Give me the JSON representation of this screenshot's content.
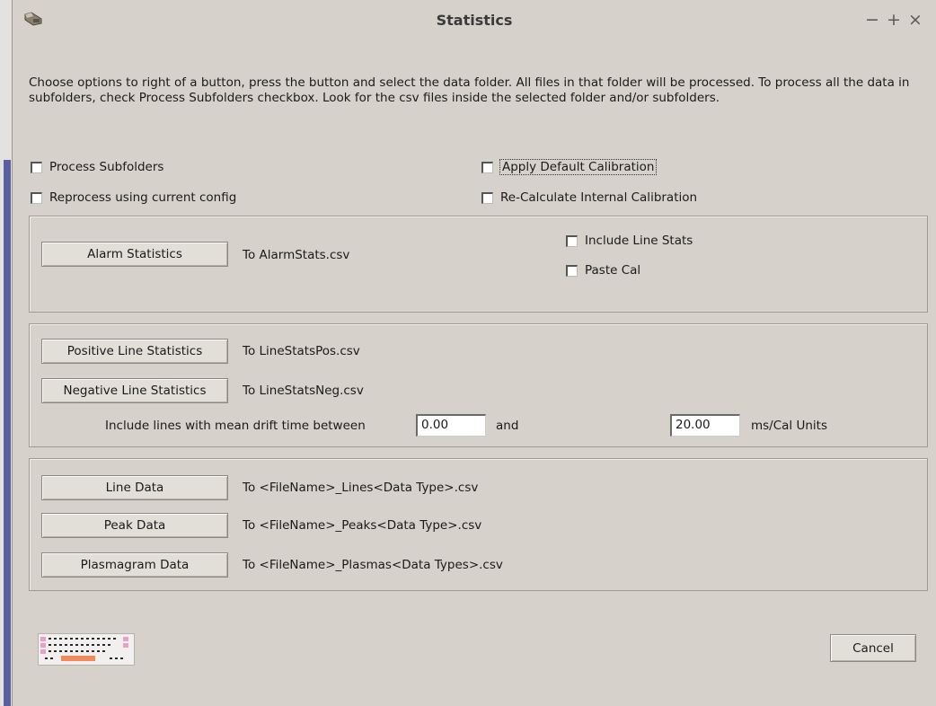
{
  "window": {
    "title": "Statistics",
    "controls": {
      "minimize": "−",
      "maximize": "+",
      "close": "×"
    }
  },
  "intro_text": "Choose options to right of a button, press the button and select the data folder. All files in that folder will be processed. To process all the data in subfolders, check Process Subfolders checkbox. Look for the csv files inside the selected folder and/or subfolders.",
  "options": {
    "process_subfolders": {
      "label": "Process Subfolders",
      "checked": false
    },
    "reprocess_current_config": {
      "label": "Reprocess using current config",
      "checked": false
    },
    "apply_default_calibration": {
      "label": "Apply Default Calibration",
      "checked": false
    },
    "recalculate_internal_calibration": {
      "label": "Re-Calculate Internal Calibration",
      "checked": false
    }
  },
  "alarm_panel": {
    "button": "Alarm Statistics",
    "target": "To AlarmStats.csv",
    "include_line_stats": {
      "label": "Include Line Stats",
      "checked": false
    },
    "paste_cal": {
      "label": "Paste Cal",
      "checked": false
    }
  },
  "line_stats_panel": {
    "positive_button": "Positive Line Statistics",
    "positive_target": "To LineStatsPos.csv",
    "negative_button": "Negative Line Statistics",
    "negative_target": "To LineStatsNeg.csv",
    "range_label": "Include lines with mean drift time between",
    "min_value": "0.00",
    "and_label": "and",
    "max_value": "20.00",
    "units_label": "ms/Cal Units"
  },
  "data_panel": {
    "line_button": "Line Data",
    "line_target": "To <FileName>_Lines<Data Type>.csv",
    "peak_button": "Peak Data",
    "peak_target": "To <FileName>_Peaks<Data Type>.csv",
    "plasmagram_button": "Plasmagram Data",
    "plasmagram_target": "To <FileName>_Plasmas<Data Types>.csv"
  },
  "footer": {
    "keyboard_icon": "keyboard-icon",
    "cancel_button": "Cancel"
  }
}
